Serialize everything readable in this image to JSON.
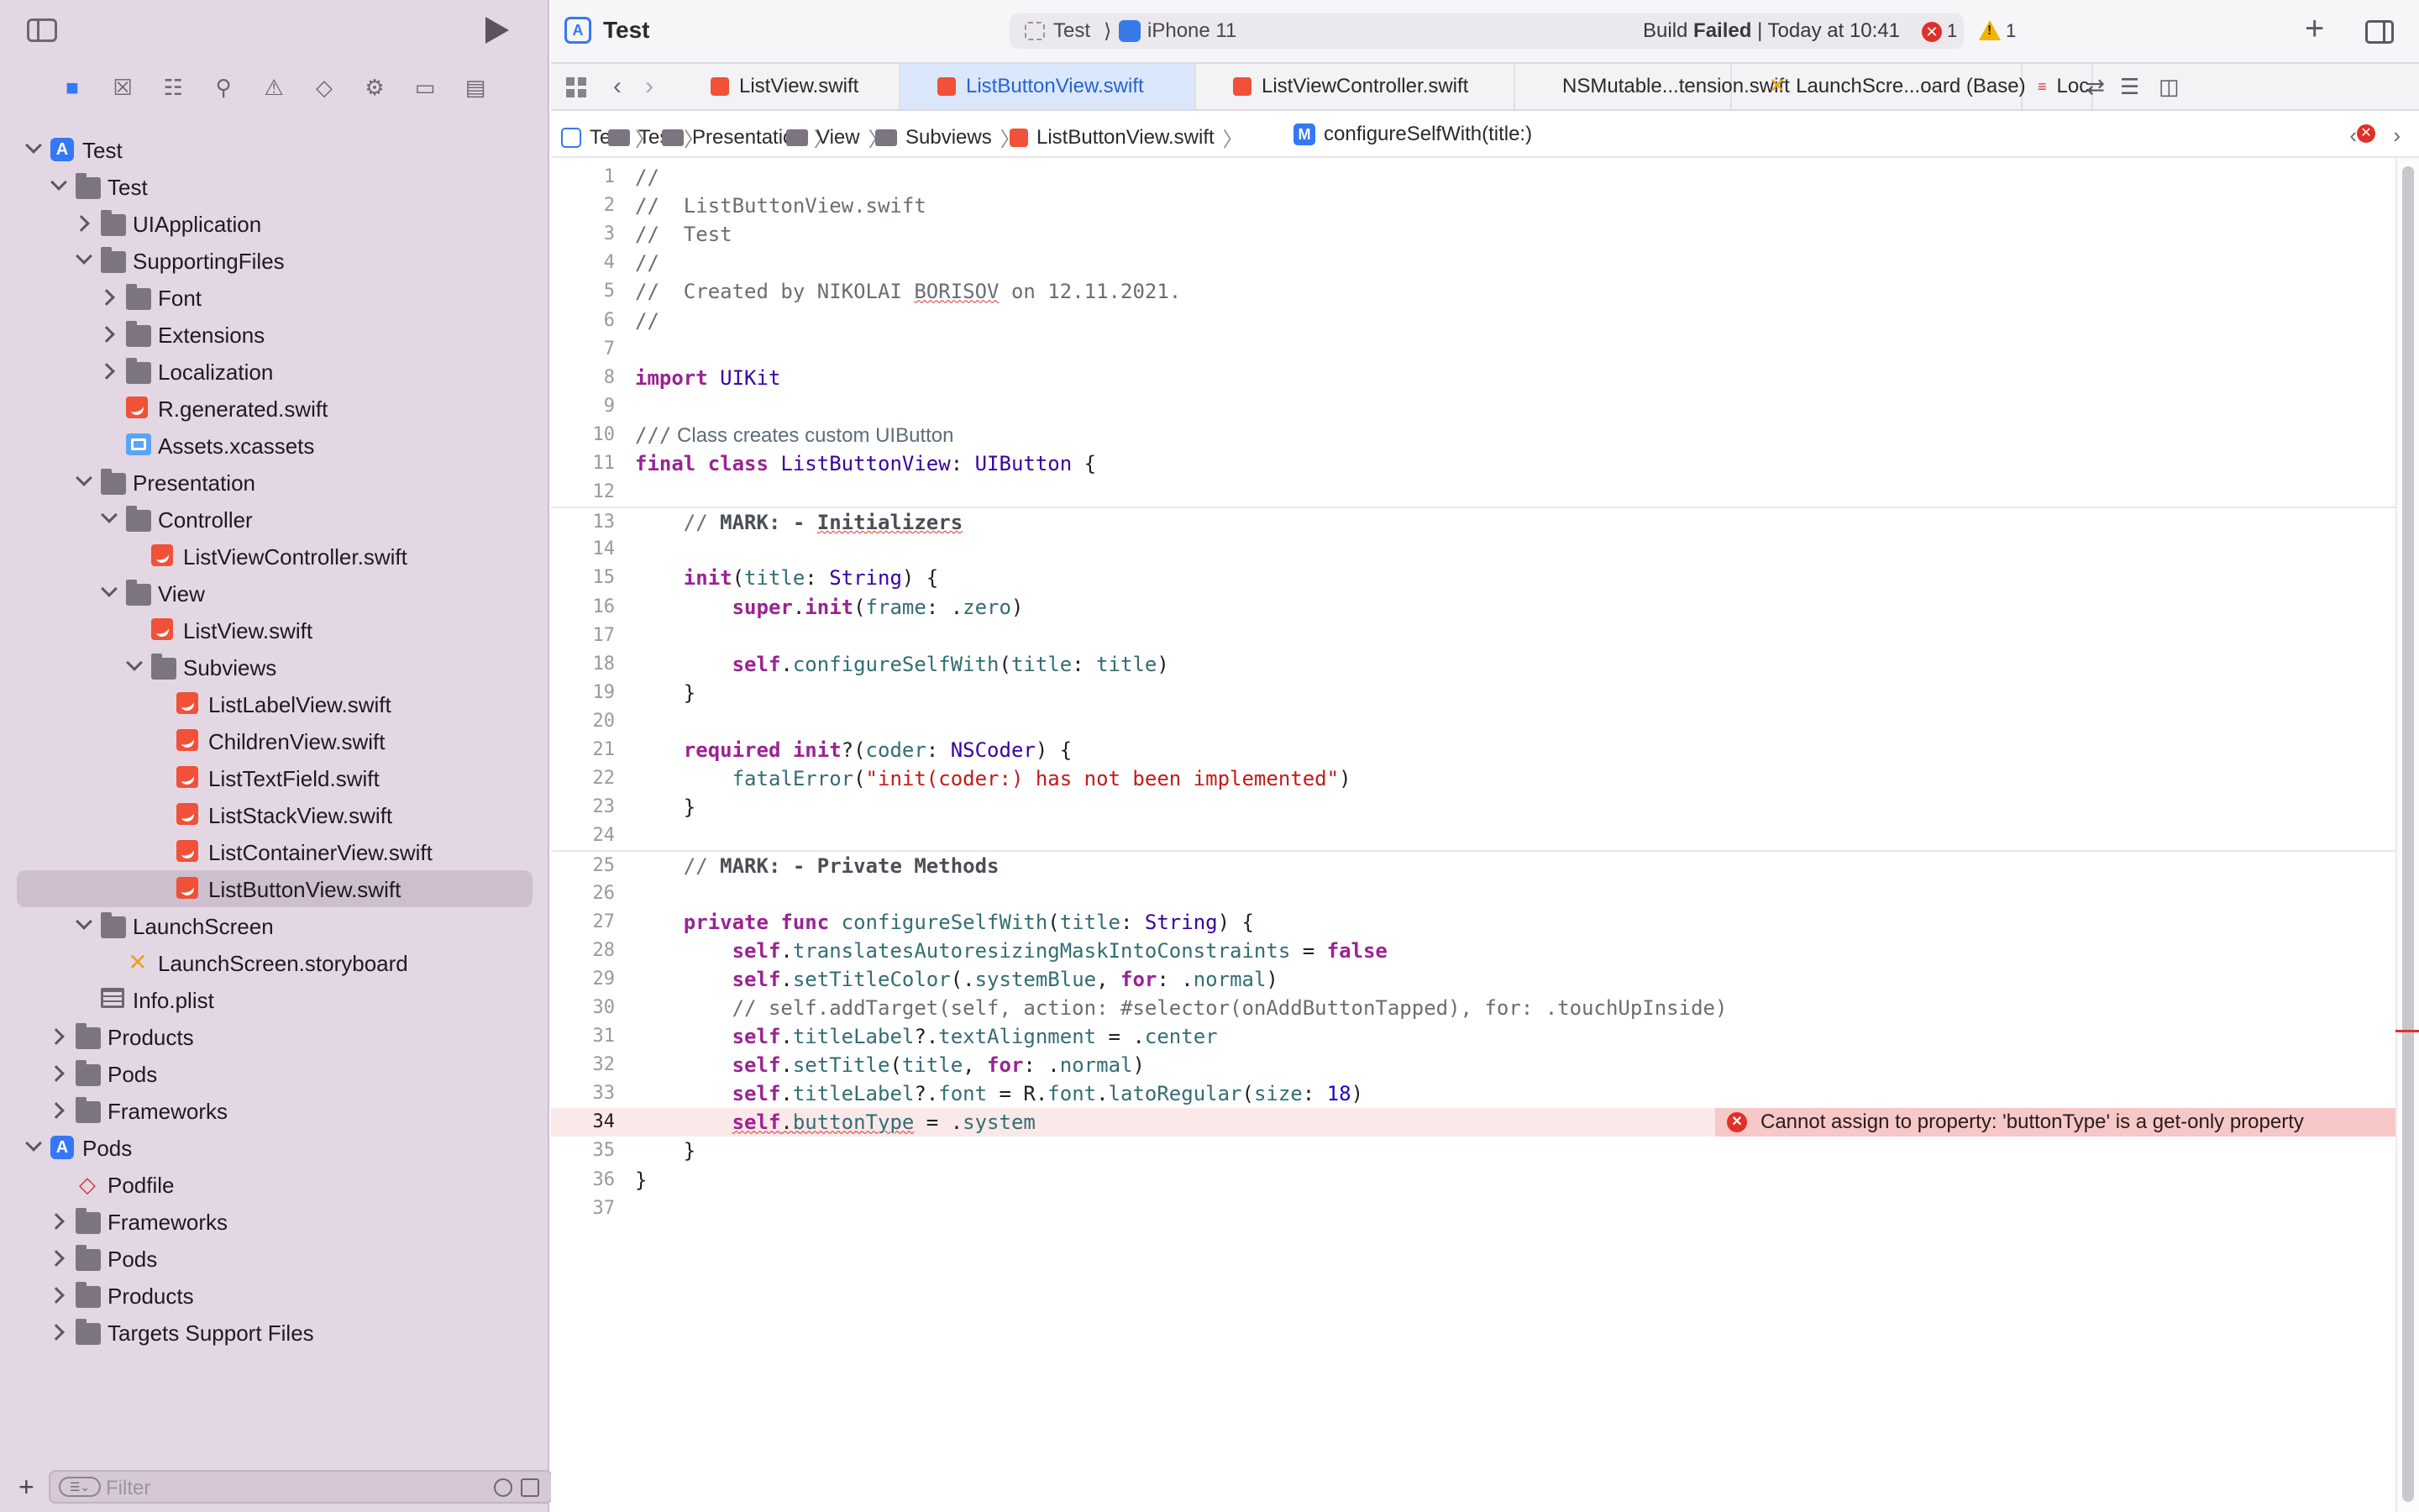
{
  "project": {
    "title": "Test"
  },
  "activity": {
    "scheme": "Test",
    "device": "iPhone 11",
    "status_prefix": "Build ",
    "status_bold": "Failed",
    "status_suffix": " | Today at 10:41",
    "errors": "1",
    "warnings": "1"
  },
  "sidebar": {
    "tree": [
      {
        "label": "Test",
        "kind": "project",
        "depth": 0,
        "chev": "open"
      },
      {
        "label": "Test",
        "kind": "folder",
        "depth": 1,
        "chev": "open"
      },
      {
        "label": "UIApplication",
        "kind": "folder",
        "depth": 2,
        "chev": "closed"
      },
      {
        "label": "SupportingFiles",
        "kind": "folder",
        "depth": 2,
        "chev": "open"
      },
      {
        "label": "Font",
        "kind": "folder",
        "depth": 3,
        "chev": "closed"
      },
      {
        "label": "Extensions",
        "kind": "folder",
        "depth": 3,
        "chev": "closed"
      },
      {
        "label": "Localization",
        "kind": "folder",
        "depth": 3,
        "chev": "closed"
      },
      {
        "label": "R.generated.swift",
        "kind": "swift",
        "depth": 3,
        "chev": ""
      },
      {
        "label": "Assets.xcassets",
        "kind": "assets",
        "depth": 3,
        "chev": ""
      },
      {
        "label": "Presentation",
        "kind": "folder",
        "depth": 2,
        "chev": "open"
      },
      {
        "label": "Controller",
        "kind": "folder",
        "depth": 3,
        "chev": "open"
      },
      {
        "label": "ListViewController.swift",
        "kind": "swift",
        "depth": 4,
        "chev": ""
      },
      {
        "label": "View",
        "kind": "folder",
        "depth": 3,
        "chev": "open"
      },
      {
        "label": "ListView.swift",
        "kind": "swift",
        "depth": 4,
        "chev": ""
      },
      {
        "label": "Subviews",
        "kind": "folder",
        "depth": 4,
        "chev": "open"
      },
      {
        "label": "ListLabelView.swift",
        "kind": "swift",
        "depth": 5,
        "chev": ""
      },
      {
        "label": "ChildrenView.swift",
        "kind": "swift",
        "depth": 5,
        "chev": ""
      },
      {
        "label": "ListTextField.swift",
        "kind": "swift",
        "depth": 5,
        "chev": ""
      },
      {
        "label": "ListStackView.swift",
        "kind": "swift",
        "depth": 5,
        "chev": ""
      },
      {
        "label": "ListContainerView.swift",
        "kind": "swift",
        "depth": 5,
        "chev": ""
      },
      {
        "label": "ListButtonView.swift",
        "kind": "swift",
        "depth": 5,
        "chev": "",
        "selected": true
      },
      {
        "label": "LaunchScreen",
        "kind": "folder",
        "depth": 2,
        "chev": "open"
      },
      {
        "label": "LaunchScreen.storyboard",
        "kind": "story",
        "depth": 3,
        "chev": ""
      },
      {
        "label": "Info.plist",
        "kind": "plist",
        "depth": 2,
        "chev": ""
      },
      {
        "label": "Products",
        "kind": "folder",
        "depth": 1,
        "chev": "closed"
      },
      {
        "label": "Pods",
        "kind": "folder",
        "depth": 1,
        "chev": "closed"
      },
      {
        "label": "Frameworks",
        "kind": "folder",
        "depth": 1,
        "chev": "closed"
      },
      {
        "label": "Pods",
        "kind": "project",
        "depth": 0,
        "chev": "open"
      },
      {
        "label": "Podfile",
        "kind": "podfile",
        "depth": 1,
        "chev": ""
      },
      {
        "label": "Frameworks",
        "kind": "folder",
        "depth": 1,
        "chev": "closed"
      },
      {
        "label": "Pods",
        "kind": "folder",
        "depth": 1,
        "chev": "closed"
      },
      {
        "label": "Products",
        "kind": "folder",
        "depth": 1,
        "chev": "closed"
      },
      {
        "label": "Targets Support Files",
        "kind": "folder",
        "depth": 1,
        "chev": "closed"
      }
    ],
    "filter_placeholder": "Filter"
  },
  "tabs": [
    {
      "label": "ListView.swift",
      "icon": "swift",
      "active": false
    },
    {
      "label": "ListButtonView.swift",
      "icon": "swift",
      "active": true
    },
    {
      "label": "ListViewController.swift",
      "icon": "swift",
      "active": false
    },
    {
      "label": "NSMutable...tension.swift",
      "icon": "swift",
      "active": false
    },
    {
      "label": "LaunchScre...oard (Base)",
      "icon": "storyboard",
      "active": false
    },
    {
      "label": "Local",
      "icon": "strings",
      "active": false
    }
  ],
  "jumpbar": {
    "items": [
      "Test",
      "Test",
      "Presentation",
      "View",
      "Subviews",
      "ListButtonView.swift",
      "configureSelfWith(title:)"
    ]
  },
  "editor": {
    "error_message": "Cannot assign to property: 'buttonType' is a get-only property",
    "lines": [
      {
        "n": "1",
        "code": "//"
      },
      {
        "n": "2",
        "code": "//  ListButtonView.swift"
      },
      {
        "n": "3",
        "code": "//  Test"
      },
      {
        "n": "4",
        "code": "//"
      },
      {
        "n": "5",
        "code": "//  Created by NIKOLAI BORISOV on 12.11.2021."
      },
      {
        "n": "6",
        "code": "//"
      },
      {
        "n": "7",
        "code": ""
      },
      {
        "n": "8",
        "code": "import UIKit"
      },
      {
        "n": "9",
        "code": ""
      },
      {
        "n": "10",
        "code": "/// Class creates custom UIButton"
      },
      {
        "n": "11",
        "code": "final class ListButtonView: UIButton {"
      },
      {
        "n": "12",
        "code": ""
      },
      {
        "n": "13",
        "code": "    // MARK: - Initializers"
      },
      {
        "n": "14",
        "code": ""
      },
      {
        "n": "15",
        "code": "    init(title: String) {"
      },
      {
        "n": "16",
        "code": "        super.init(frame: .zero)"
      },
      {
        "n": "17",
        "code": ""
      },
      {
        "n": "18",
        "code": "        self.configureSelfWith(title: title)"
      },
      {
        "n": "19",
        "code": "    }"
      },
      {
        "n": "20",
        "code": ""
      },
      {
        "n": "21",
        "code": "    required init?(coder: NSCoder) {"
      },
      {
        "n": "22",
        "code": "        fatalError(\"init(coder:) has not been implemented\")"
      },
      {
        "n": "23",
        "code": "    }"
      },
      {
        "n": "24",
        "code": ""
      },
      {
        "n": "25",
        "code": "    // MARK: - Private Methods"
      },
      {
        "n": "26",
        "code": ""
      },
      {
        "n": "27",
        "code": "    private func configureSelfWith(title: String) {"
      },
      {
        "n": "28",
        "code": "        self.translatesAutoresizingMaskIntoConstraints = false"
      },
      {
        "n": "29",
        "code": "        self.setTitleColor(.systemBlue, for: .normal)"
      },
      {
        "n": "30",
        "code": "        // self.addTarget(self, action: #selector(onAddButtonTapped), for: .touchUpInside)"
      },
      {
        "n": "31",
        "code": "        self.titleLabel?.textAlignment = .center"
      },
      {
        "n": "32",
        "code": "        self.setTitle(title, for: .normal)"
      },
      {
        "n": "33",
        "code": "        self.titleLabel?.font = R.font.latoRegular(size: 18)"
      },
      {
        "n": "34",
        "code": "        self.buttonType = .system"
      },
      {
        "n": "35",
        "code": "    }"
      },
      {
        "n": "36",
        "code": "}"
      },
      {
        "n": "37",
        "code": ""
      }
    ]
  }
}
